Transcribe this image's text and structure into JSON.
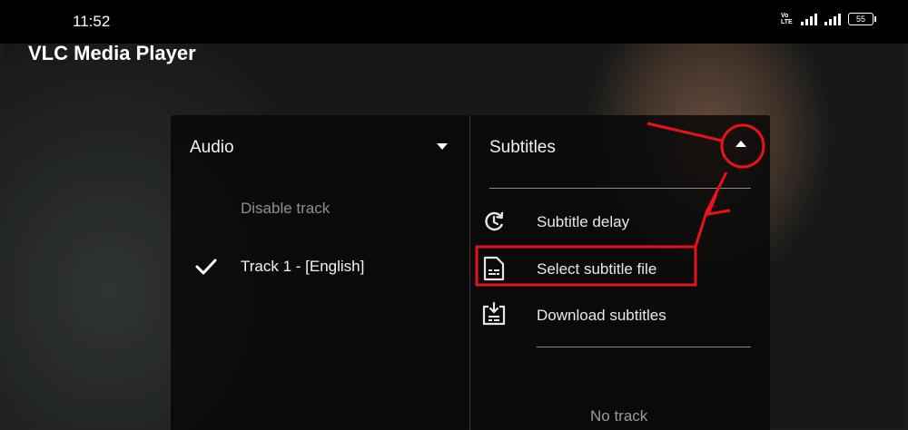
{
  "status_bar": {
    "time": "11:52",
    "network_label": "Vo\nLTE",
    "battery": "55"
  },
  "app": {
    "title": "VLC Media Player"
  },
  "audio": {
    "header": "Audio",
    "tracks": [
      {
        "label": "Disable track",
        "selected": false
      },
      {
        "label": "Track 1 - [English]",
        "selected": true
      }
    ]
  },
  "subtitles": {
    "header": "Subtitles",
    "menu": [
      {
        "label": "Subtitle delay",
        "icon": "subtitle-delay-icon"
      },
      {
        "label": "Select subtitle file",
        "icon": "subtitle-file-icon"
      },
      {
        "label": "Download subtitles",
        "icon": "download-subtitles-icon"
      }
    ],
    "empty_text": "No track"
  },
  "annotation": {
    "color": "#e8121b"
  }
}
